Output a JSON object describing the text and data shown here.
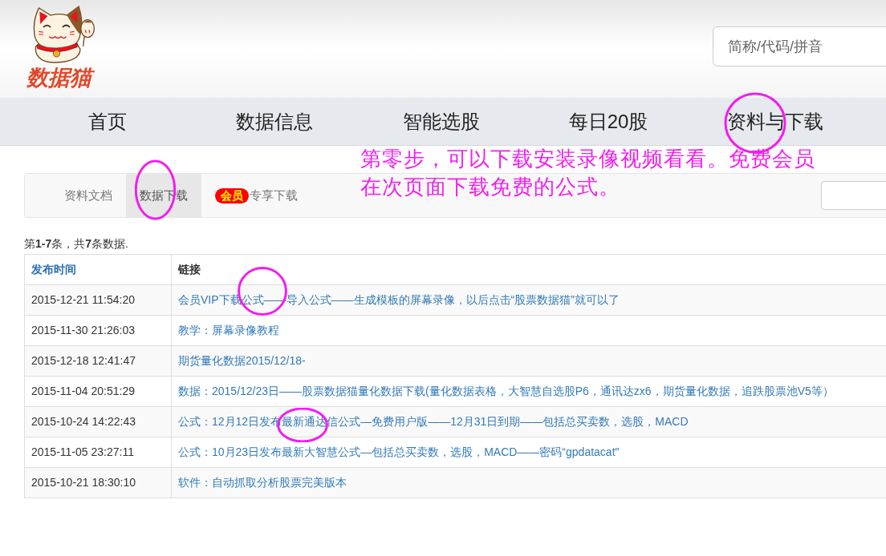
{
  "header": {
    "logo_text": "数据猫",
    "search": {
      "placeholder": "简称/代码/拼音"
    }
  },
  "nav": [
    "首页",
    "数据信息",
    "智能选股",
    "每日20股",
    "资料与下载"
  ],
  "annotation": {
    "lines": [
      "第零步，可以下载安装录像视频看看。免费会员",
      "在次页面下载免费的公式。"
    ]
  },
  "subnav": {
    "tabs": [
      {
        "label": "资料文档",
        "selected": false
      },
      {
        "label": "数据下载",
        "selected": true
      },
      {
        "label": "专享下载",
        "badge": "会员",
        "selected": false
      }
    ]
  },
  "summary": "第**1-7**条，共**7**条数据.",
  "table": {
    "columns": [
      {
        "label": "发布时间",
        "link": true
      },
      {
        "label": "链接",
        "link": false
      }
    ],
    "rows": [
      {
        "time": "2015-12-21 11:54:20",
        "link": "会员VIP下载公式——导入公式——生成模板的屏幕录像，以后点击“股票数据猫”就可以了"
      },
      {
        "time": "2015-11-30 21:26:03",
        "link": "教学：屏幕录像教程"
      },
      {
        "time": "2015-12-18 12:41:47",
        "link": "期货量化数据2015/12/18-"
      },
      {
        "time": "2015-11-04 20:51:29",
        "link": "数据：2015/12/23日——股票数据猫量化数据下载(量化数据表格，大智慧自选股P6，通讯达zx6，期货量化数据，追跌股票池V5等）"
      },
      {
        "time": "2015-10-24 14:22:43",
        "link": "公式：12月12日发布最新通达信公式—免费用户版——12月31日到期——包括总买卖数，选股，MACD"
      },
      {
        "time": "2015-11-05 23:27:11",
        "link": "公式：10月23日发布最新大智慧公式—包括总买卖数，选股，MACD——密码“gpdatacat\""
      },
      {
        "time": "2015-10-21 18:30:10",
        "link": "软件：自动抓取分析股票完美版本"
      }
    ]
  }
}
